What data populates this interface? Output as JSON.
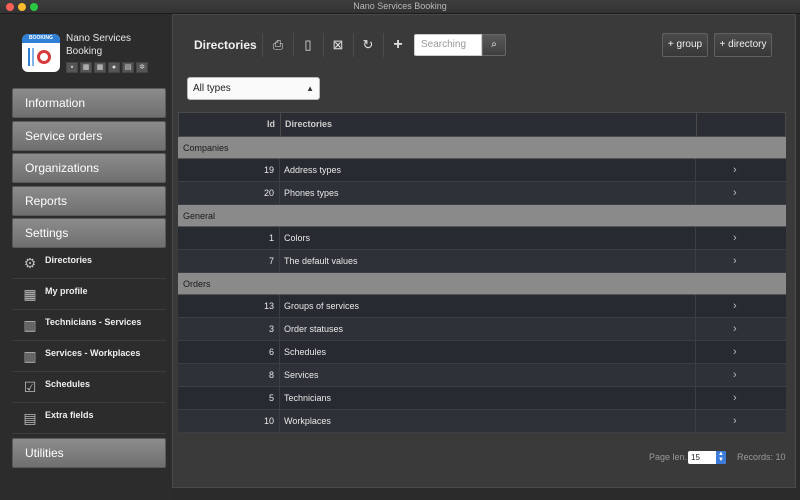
{
  "window": {
    "title": "Nano Services Booking"
  },
  "brand": {
    "name": "Nano Services Booking",
    "logo_text": "BOOKING"
  },
  "sidebar": {
    "menu": [
      {
        "label": "Information"
      },
      {
        "label": "Service orders"
      },
      {
        "label": "Organizations"
      },
      {
        "label": "Reports"
      },
      {
        "label": "Settings"
      }
    ],
    "settings_items": [
      {
        "label": "Directories",
        "icon": "gears-icon"
      },
      {
        "label": "My profile",
        "icon": "grid-icon"
      },
      {
        "label": "Technicians - Services",
        "icon": "map-icon"
      },
      {
        "label": "Services - Workplaces",
        "icon": "map-icon"
      },
      {
        "label": "Schedules",
        "icon": "calendar-check-icon"
      },
      {
        "label": "Extra fields",
        "icon": "newspaper-icon"
      }
    ],
    "utilities": {
      "label": "Utilities"
    }
  },
  "toolbar": {
    "title": "Directories",
    "search_placeholder": "Searching",
    "add_group_label": "+ group",
    "add_directory_label": "+ directory"
  },
  "filter": {
    "selected": "All types"
  },
  "table": {
    "headers": {
      "id": "Id",
      "directories": "Directories"
    },
    "groups": [
      {
        "name": "Companies",
        "rows": [
          {
            "id": "19",
            "name": "Address types"
          },
          {
            "id": "20",
            "name": "Phones types"
          }
        ]
      },
      {
        "name": "General",
        "rows": [
          {
            "id": "1",
            "name": "Colors"
          },
          {
            "id": "7",
            "name": "The default values"
          }
        ]
      },
      {
        "name": "Orders",
        "rows": [
          {
            "id": "13",
            "name": "Groups of services"
          },
          {
            "id": "3",
            "name": "Order statuses"
          },
          {
            "id": "6",
            "name": "Schedules"
          },
          {
            "id": "8",
            "name": "Services"
          },
          {
            "id": "5",
            "name": "Technicians"
          },
          {
            "id": "10",
            "name": "Workplaces"
          }
        ]
      }
    ]
  },
  "footer": {
    "page_len_label": "Page len.",
    "page_len_value": "15",
    "records_label": "Records: 10"
  },
  "colors": {
    "group_header": "#8a8a8a",
    "row_bg": "#272b31",
    "accent": "#3c7bd9"
  }
}
